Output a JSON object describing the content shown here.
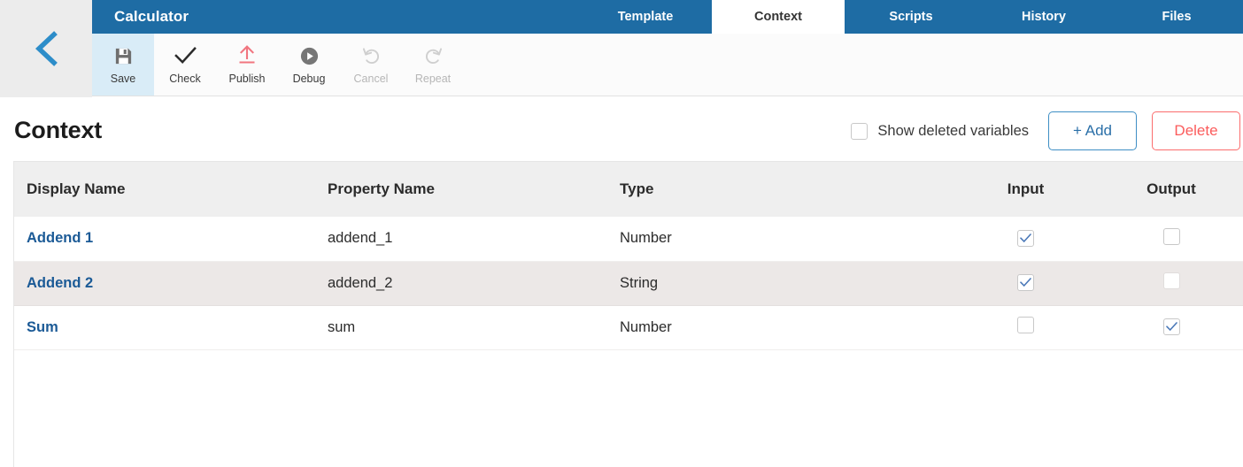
{
  "app": {
    "title": "Calculator",
    "back_icon": "chevron-left-icon"
  },
  "tabs": [
    {
      "label": "Template",
      "active": false
    },
    {
      "label": "Context",
      "active": true
    },
    {
      "label": "Scripts",
      "active": false
    },
    {
      "label": "History",
      "active": false
    },
    {
      "label": "Files",
      "active": false
    }
  ],
  "toolbar": [
    {
      "label": "Save",
      "icon": "save-icon",
      "state": "highlighted"
    },
    {
      "label": "Check",
      "icon": "check-icon",
      "state": "enabled"
    },
    {
      "label": "Publish",
      "icon": "publish-icon",
      "state": "enabled"
    },
    {
      "label": "Debug",
      "icon": "debug-icon",
      "state": "enabled"
    },
    {
      "label": "Cancel",
      "icon": "undo-icon",
      "state": "disabled"
    },
    {
      "label": "Repeat",
      "icon": "redo-icon",
      "state": "disabled"
    }
  ],
  "page": {
    "title": "Context",
    "show_deleted_label": "Show deleted variables",
    "show_deleted_checked": false,
    "add_label": "+ Add",
    "delete_label": "Delete"
  },
  "table": {
    "columns": [
      "Display Name",
      "Property Name",
      "Type",
      "Input",
      "Output"
    ],
    "rows": [
      {
        "display_name": "Addend 1",
        "property_name": "addend_1",
        "type": "Number",
        "input": true,
        "output": false,
        "output_dim": false
      },
      {
        "display_name": "Addend 2",
        "property_name": "addend_2",
        "type": "String",
        "input": true,
        "output": false,
        "output_dim": true
      },
      {
        "display_name": "Sum",
        "property_name": "sum",
        "type": "Number",
        "input": false,
        "output": true,
        "output_dim": false
      }
    ]
  },
  "colors": {
    "brand_blue": "#1e6ca4",
    "link_blue": "#1b5a96",
    "accent_red": "#fb5c5c",
    "toolbar_highlight": "#d9ecf7",
    "row_alt": "#ece8e7",
    "header_row": "#efefef"
  }
}
